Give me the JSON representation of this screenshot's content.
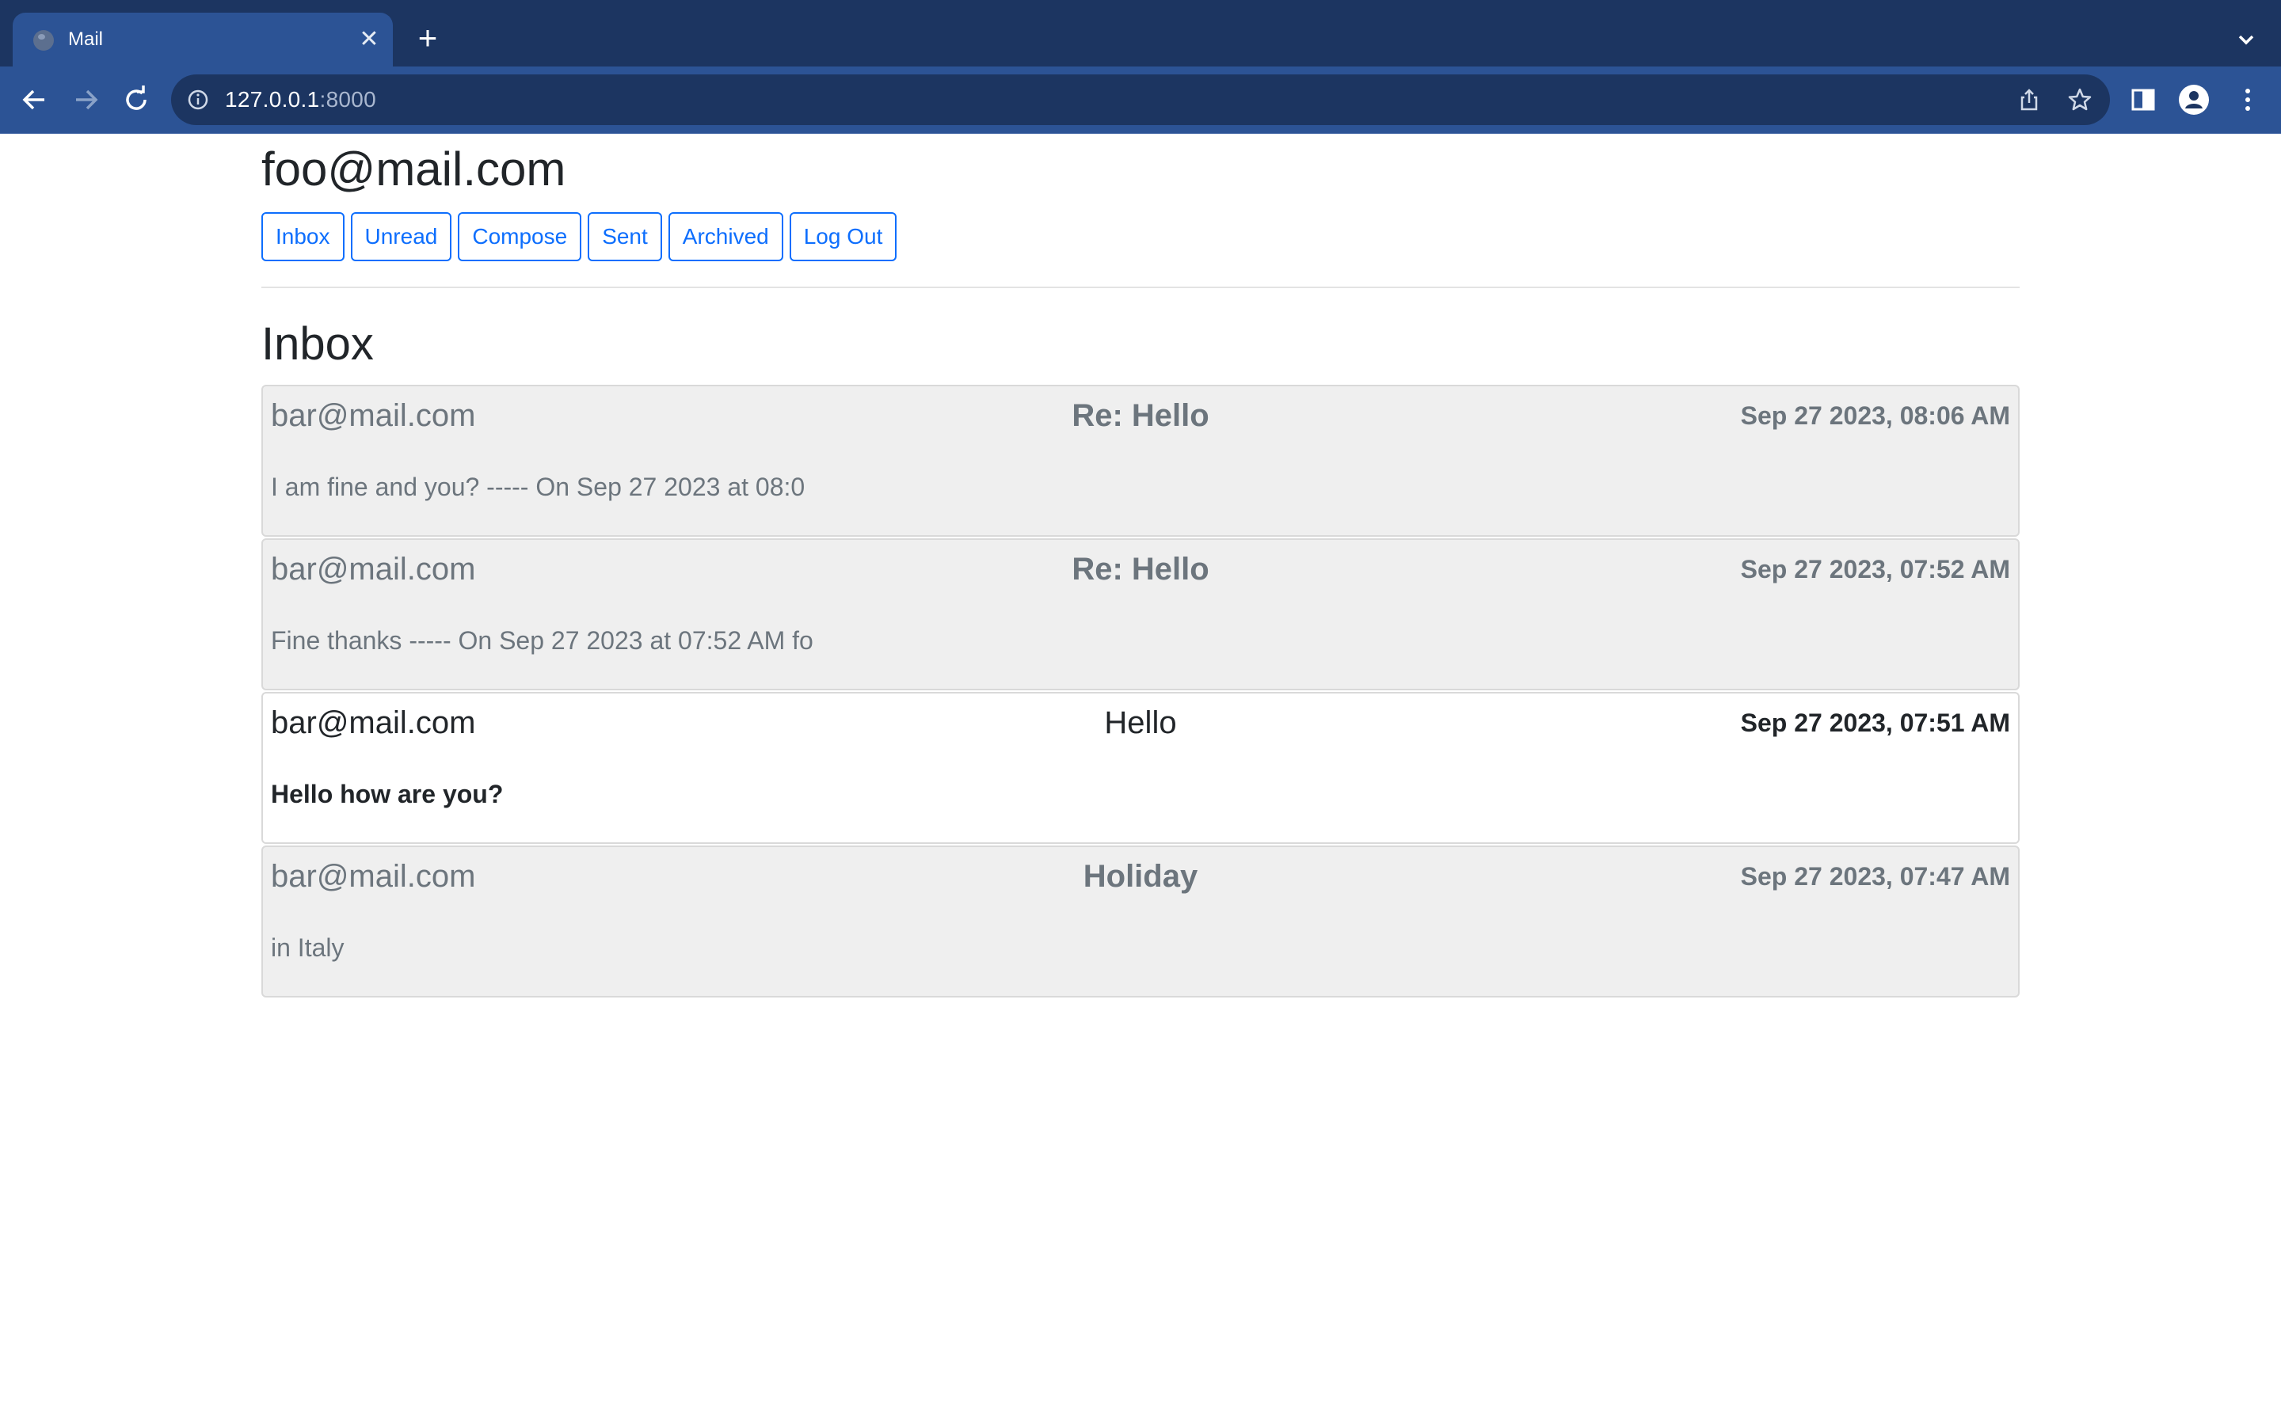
{
  "browser": {
    "tab_title": "Mail",
    "url_host": "127.0.0.1",
    "url_port": ":8000"
  },
  "page": {
    "user_email": "foo@mail.com",
    "nav": {
      "inbox": "Inbox",
      "unread": "Unread",
      "compose": "Compose",
      "sent": "Sent",
      "archived": "Archived",
      "logout": "Log Out"
    },
    "section_title": "Inbox"
  },
  "emails": [
    {
      "sender": "bar@mail.com",
      "subject": "Re: Hello",
      "date": "Sep 27 2023, 08:06 AM",
      "preview": "I am fine and you? ----- On Sep 27 2023 at 08:0",
      "read": true
    },
    {
      "sender": "bar@mail.com",
      "subject": "Re: Hello",
      "date": "Sep 27 2023, 07:52 AM",
      "preview": "Fine thanks ----- On Sep 27 2023 at 07:52 AM fo",
      "read": true
    },
    {
      "sender": "bar@mail.com",
      "subject": "Hello",
      "date": "Sep 27 2023, 07:51 AM",
      "preview": "Hello how are you?",
      "read": false
    },
    {
      "sender": "bar@mail.com",
      "subject": "Holiday",
      "date": "Sep 27 2023, 07:47 AM",
      "preview": "in Italy",
      "read": true
    }
  ],
  "colors": {
    "tabstrip": "#1c3561",
    "toolbar": "#2c5395",
    "accent": "#0d6efd",
    "read_row_bg": "#efefef",
    "unread_row_bg": "#ffffff"
  }
}
